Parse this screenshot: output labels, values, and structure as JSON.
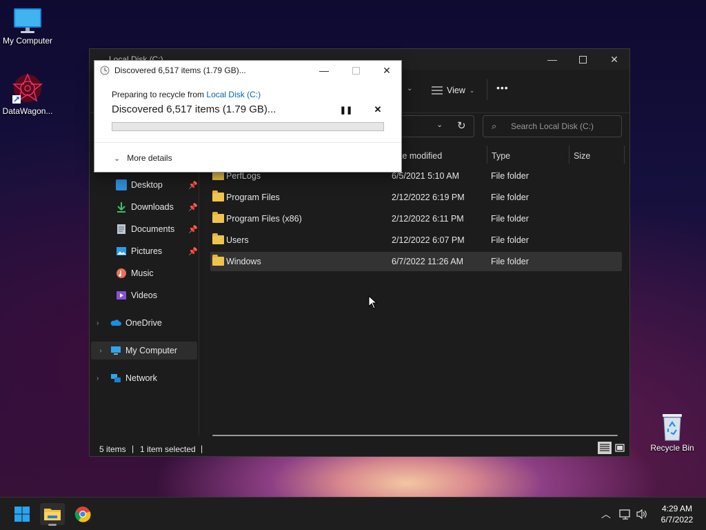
{
  "desktop": {
    "icons": [
      {
        "label": "My Computer"
      },
      {
        "label": "DataWagon..."
      },
      {
        "label": "Recycle Bin"
      }
    ]
  },
  "explorer": {
    "title": "Local Disk (C:)",
    "toolbar": {
      "view_label": "View",
      "more_label": "•••"
    },
    "search_placeholder": "Search Local Disk (C:)",
    "columns": {
      "date": "te modified",
      "type": "Type",
      "size": "Size"
    },
    "nav": {
      "quick": [
        {
          "label": "Desktop",
          "icon": "desktop-icon"
        },
        {
          "label": "Downloads",
          "icon": "download-icon"
        },
        {
          "label": "Documents",
          "icon": "document-icon"
        },
        {
          "label": "Pictures",
          "icon": "pictures-icon"
        },
        {
          "label": "Music",
          "icon": "music-icon"
        },
        {
          "label": "Videos",
          "icon": "videos-icon"
        }
      ],
      "onedrive": "OneDrive",
      "mycomputer": "My Computer",
      "network": "Network"
    },
    "rows": [
      {
        "name": "PerfLogs",
        "date": "6/5/2021 5:10 AM",
        "type": "File folder"
      },
      {
        "name": "Program Files",
        "date": "2/12/2022 6:19 PM",
        "type": "File folder"
      },
      {
        "name": "Program Files (x86)",
        "date": "2/12/2022 6:11 PM",
        "type": "File folder"
      },
      {
        "name": "Users",
        "date": "2/12/2022 6:07 PM",
        "type": "File folder"
      },
      {
        "name": "Windows",
        "date": "6/7/2022 11:26 AM",
        "type": "File folder"
      }
    ],
    "status": {
      "items": "5 items",
      "sep": "|",
      "selected": "1 item selected",
      "sep2": "|"
    }
  },
  "dialog": {
    "title": "Discovered 6,517 items (1.79 GB)...",
    "preparing_prefix": "Preparing to recycle from ",
    "source_link": "Local Disk (C:)",
    "headline": "Discovered 6,517 items (1.79 GB)...",
    "progress": 0,
    "more_details": "More details"
  },
  "taskbar": {
    "time": "4:29 AM",
    "date": "6/7/2022"
  },
  "colors": {
    "accent": "#0078d4",
    "link": "#0063b1",
    "folder": "#f0c44c"
  }
}
